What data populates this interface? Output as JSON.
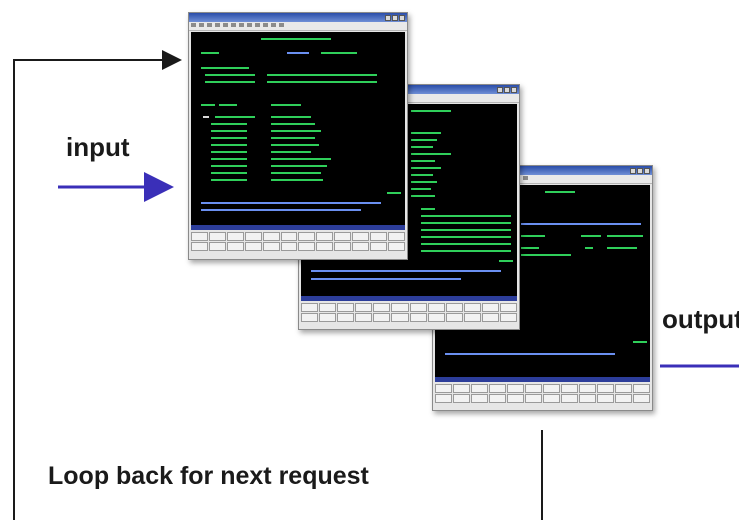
{
  "labels": {
    "input": "input",
    "output": "output",
    "loop": "Loop back for next request"
  },
  "colors": {
    "input_arrow": "#3a2fb8",
    "output_arrow": "#3a2fb8",
    "loop_line": "#222222",
    "terminal_green": "#2fcf5a",
    "terminal_blue": "#6a8ff0"
  },
  "windows": [
    {
      "icon": "terminal-window-1"
    },
    {
      "icon": "terminal-window-2"
    },
    {
      "icon": "terminal-window-3"
    }
  ]
}
